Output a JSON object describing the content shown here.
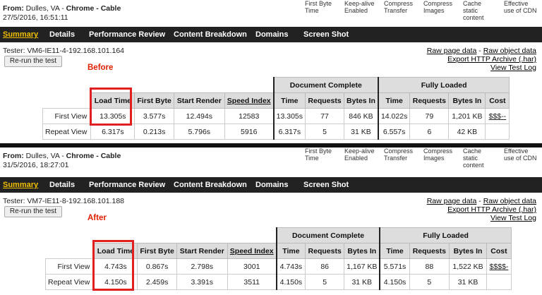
{
  "options_headers": [
    "First Byte\nTime",
    "Keep-alive\nEnabled",
    "Compress\nTransfer",
    "Compress\nImages",
    "Cache\nstatic\ncontent",
    "Effective\nuse of CDN"
  ],
  "nav": [
    "Summary",
    "Details",
    "Performance Review",
    "Content Breakdown",
    "Domains",
    "Screen Shot"
  ],
  "rerun_label": "Re-run the test",
  "links": {
    "raw_page": "Raw page data",
    "sep": " - ",
    "raw_object": "Raw object data",
    "har": "Export HTTP Archive (.har)",
    "log": "View Test Log"
  },
  "table_headers": {
    "document_complete": "Document Complete",
    "fully_loaded": "Fully Loaded",
    "columns": [
      "Load Time",
      "First Byte",
      "Start Render",
      "Speed Index",
      "Time",
      "Requests",
      "Bytes In",
      "Time",
      "Requests",
      "Bytes In",
      "Cost"
    ]
  },
  "panels": [
    {
      "from_label": "From:",
      "from_value": " Dulles, VA - ",
      "browser": "Chrome",
      "connection": " - Cable",
      "date": "27/5/2016, 16:51:11",
      "tester": "Tester: VM6-IE11-4-192.168.101.164",
      "tag": "Before",
      "rows": [
        {
          "label": "First View",
          "cells": [
            "13.305s",
            "3.577s",
            "12.494s",
            "12583",
            "13.305s",
            "77",
            "846 KB",
            "14.022s",
            "79",
            "1,201 KB",
            "$$$--"
          ]
        },
        {
          "label": "Repeat View",
          "cells": [
            "6.317s",
            "0.213s",
            "5.796s",
            "5916",
            "6.317s",
            "5",
            "31 KB",
            "6.557s",
            "6",
            "42 KB",
            ""
          ]
        }
      ]
    },
    {
      "from_label": "From:",
      "from_value": " Dulles, VA - ",
      "browser": "Chrome",
      "connection": " - Cable",
      "date": "31/5/2016, 18:27:01",
      "tester": "Tester: VM7-IE11-8-192.168.101.188",
      "tag": "After",
      "rows": [
        {
          "label": "First View",
          "cells": [
            "4.743s",
            "0.867s",
            "2.798s",
            "3001",
            "4.743s",
            "86",
            "1,167 KB",
            "5.571s",
            "88",
            "1,522 KB",
            "$$$$-"
          ]
        },
        {
          "label": "Repeat View",
          "cells": [
            "4.150s",
            "2.459s",
            "3.391s",
            "3511",
            "4.150s",
            "5",
            "31 KB",
            "4.150s",
            "5",
            "31 KB",
            ""
          ]
        }
      ]
    }
  ]
}
